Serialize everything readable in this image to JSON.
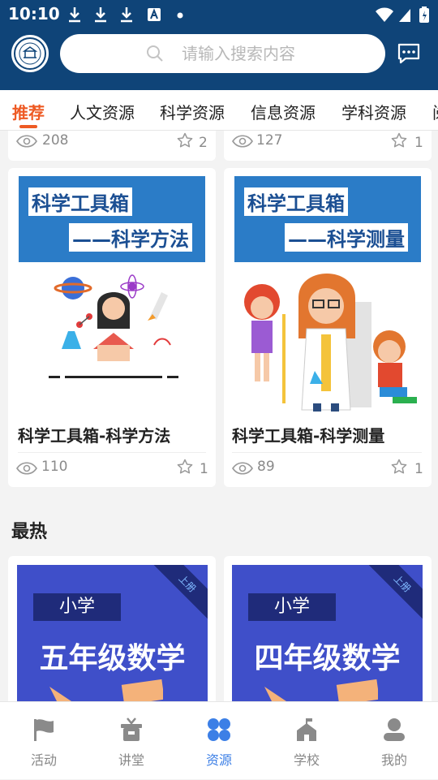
{
  "status_bar": {
    "time": "10:10"
  },
  "search": {
    "placeholder": "请输入搜索内容"
  },
  "tabs": [
    {
      "label": "推荐",
      "active": true
    },
    {
      "label": "人文资源"
    },
    {
      "label": "科学资源"
    },
    {
      "label": "信息资源"
    },
    {
      "label": "学科资源"
    },
    {
      "label": "阅"
    }
  ],
  "top_cards": [
    {
      "views": "208",
      "favorites": "2"
    },
    {
      "views": "127",
      "favorites": "1"
    }
  ],
  "cards": [
    {
      "banner_line1": "科学工具箱",
      "banner_line2": "——科学方法",
      "title": "科学工具箱-科学方法",
      "views": "110",
      "favorites": "1"
    },
    {
      "banner_line1": "科学工具箱",
      "banner_line2": "——科学测量",
      "title": "科学工具箱-科学测量",
      "views": "89",
      "favorites": "1"
    }
  ],
  "section": {
    "title": "最热"
  },
  "hot_cards": [
    {
      "level": "小学",
      "grade": "五年级数学",
      "tag": "上册"
    },
    {
      "level": "小学",
      "grade": "四年级数学",
      "tag": "上册"
    }
  ],
  "nav": [
    {
      "label": "活动",
      "icon": "flag-icon"
    },
    {
      "label": "讲堂",
      "icon": "classroom-icon"
    },
    {
      "label": "资源",
      "icon": "resources-icon",
      "active": true
    },
    {
      "label": "学校",
      "icon": "school-icon"
    },
    {
      "label": "我的",
      "icon": "profile-icon"
    }
  ],
  "colors": {
    "header": "#0f4478",
    "tab_active": "#ee5a24",
    "nav_active": "#3c7fe6",
    "math_bg": "#3f4fc9"
  }
}
